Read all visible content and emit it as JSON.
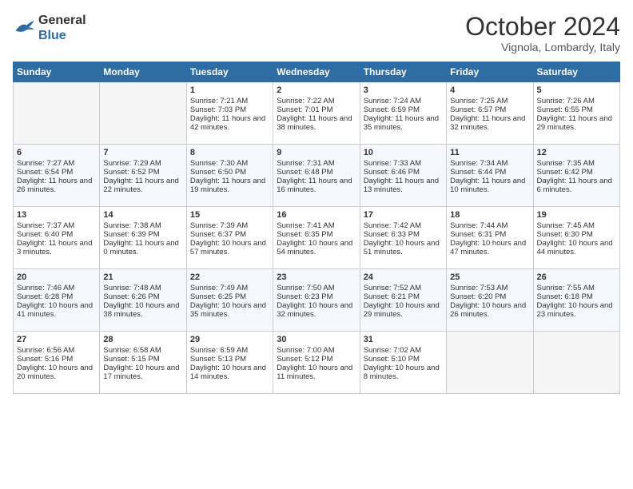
{
  "header": {
    "logo_line1": "General",
    "logo_line2": "Blue",
    "month": "October 2024",
    "location": "Vignola, Lombardy, Italy"
  },
  "days_of_week": [
    "Sunday",
    "Monday",
    "Tuesday",
    "Wednesday",
    "Thursday",
    "Friday",
    "Saturday"
  ],
  "weeks": [
    [
      {
        "day": "",
        "empty": true
      },
      {
        "day": "",
        "empty": true
      },
      {
        "day": "1",
        "sunrise": "Sunrise: 7:21 AM",
        "sunset": "Sunset: 7:03 PM",
        "daylight": "Daylight: 11 hours and 42 minutes."
      },
      {
        "day": "2",
        "sunrise": "Sunrise: 7:22 AM",
        "sunset": "Sunset: 7:01 PM",
        "daylight": "Daylight: 11 hours and 38 minutes."
      },
      {
        "day": "3",
        "sunrise": "Sunrise: 7:24 AM",
        "sunset": "Sunset: 6:59 PM",
        "daylight": "Daylight: 11 hours and 35 minutes."
      },
      {
        "day": "4",
        "sunrise": "Sunrise: 7:25 AM",
        "sunset": "Sunset: 6:57 PM",
        "daylight": "Daylight: 11 hours and 32 minutes."
      },
      {
        "day": "5",
        "sunrise": "Sunrise: 7:26 AM",
        "sunset": "Sunset: 6:55 PM",
        "daylight": "Daylight: 11 hours and 29 minutes."
      }
    ],
    [
      {
        "day": "6",
        "sunrise": "Sunrise: 7:27 AM",
        "sunset": "Sunset: 6:54 PM",
        "daylight": "Daylight: 11 hours and 26 minutes."
      },
      {
        "day": "7",
        "sunrise": "Sunrise: 7:29 AM",
        "sunset": "Sunset: 6:52 PM",
        "daylight": "Daylight: 11 hours and 22 minutes."
      },
      {
        "day": "8",
        "sunrise": "Sunrise: 7:30 AM",
        "sunset": "Sunset: 6:50 PM",
        "daylight": "Daylight: 11 hours and 19 minutes."
      },
      {
        "day": "9",
        "sunrise": "Sunrise: 7:31 AM",
        "sunset": "Sunset: 6:48 PM",
        "daylight": "Daylight: 11 hours and 16 minutes."
      },
      {
        "day": "10",
        "sunrise": "Sunrise: 7:33 AM",
        "sunset": "Sunset: 6:46 PM",
        "daylight": "Daylight: 11 hours and 13 minutes."
      },
      {
        "day": "11",
        "sunrise": "Sunrise: 7:34 AM",
        "sunset": "Sunset: 6:44 PM",
        "daylight": "Daylight: 11 hours and 10 minutes."
      },
      {
        "day": "12",
        "sunrise": "Sunrise: 7:35 AM",
        "sunset": "Sunset: 6:42 PM",
        "daylight": "Daylight: 11 hours and 6 minutes."
      }
    ],
    [
      {
        "day": "13",
        "sunrise": "Sunrise: 7:37 AM",
        "sunset": "Sunset: 6:40 PM",
        "daylight": "Daylight: 11 hours and 3 minutes."
      },
      {
        "day": "14",
        "sunrise": "Sunrise: 7:38 AM",
        "sunset": "Sunset: 6:39 PM",
        "daylight": "Daylight: 11 hours and 0 minutes."
      },
      {
        "day": "15",
        "sunrise": "Sunrise: 7:39 AM",
        "sunset": "Sunset: 6:37 PM",
        "daylight": "Daylight: 10 hours and 57 minutes."
      },
      {
        "day": "16",
        "sunrise": "Sunrise: 7:41 AM",
        "sunset": "Sunset: 6:35 PM",
        "daylight": "Daylight: 10 hours and 54 minutes."
      },
      {
        "day": "17",
        "sunrise": "Sunrise: 7:42 AM",
        "sunset": "Sunset: 6:33 PM",
        "daylight": "Daylight: 10 hours and 51 minutes."
      },
      {
        "day": "18",
        "sunrise": "Sunrise: 7:44 AM",
        "sunset": "Sunset: 6:31 PM",
        "daylight": "Daylight: 10 hours and 47 minutes."
      },
      {
        "day": "19",
        "sunrise": "Sunrise: 7:45 AM",
        "sunset": "Sunset: 6:30 PM",
        "daylight": "Daylight: 10 hours and 44 minutes."
      }
    ],
    [
      {
        "day": "20",
        "sunrise": "Sunrise: 7:46 AM",
        "sunset": "Sunset: 6:28 PM",
        "daylight": "Daylight: 10 hours and 41 minutes."
      },
      {
        "day": "21",
        "sunrise": "Sunrise: 7:48 AM",
        "sunset": "Sunset: 6:26 PM",
        "daylight": "Daylight: 10 hours and 38 minutes."
      },
      {
        "day": "22",
        "sunrise": "Sunrise: 7:49 AM",
        "sunset": "Sunset: 6:25 PM",
        "daylight": "Daylight: 10 hours and 35 minutes."
      },
      {
        "day": "23",
        "sunrise": "Sunrise: 7:50 AM",
        "sunset": "Sunset: 6:23 PM",
        "daylight": "Daylight: 10 hours and 32 minutes."
      },
      {
        "day": "24",
        "sunrise": "Sunrise: 7:52 AM",
        "sunset": "Sunset: 6:21 PM",
        "daylight": "Daylight: 10 hours and 29 minutes."
      },
      {
        "day": "25",
        "sunrise": "Sunrise: 7:53 AM",
        "sunset": "Sunset: 6:20 PM",
        "daylight": "Daylight: 10 hours and 26 minutes."
      },
      {
        "day": "26",
        "sunrise": "Sunrise: 7:55 AM",
        "sunset": "Sunset: 6:18 PM",
        "daylight": "Daylight: 10 hours and 23 minutes."
      }
    ],
    [
      {
        "day": "27",
        "sunrise": "Sunrise: 6:56 AM",
        "sunset": "Sunset: 5:16 PM",
        "daylight": "Daylight: 10 hours and 20 minutes."
      },
      {
        "day": "28",
        "sunrise": "Sunrise: 6:58 AM",
        "sunset": "Sunset: 5:15 PM",
        "daylight": "Daylight: 10 hours and 17 minutes."
      },
      {
        "day": "29",
        "sunrise": "Sunrise: 6:59 AM",
        "sunset": "Sunset: 5:13 PM",
        "daylight": "Daylight: 10 hours and 14 minutes."
      },
      {
        "day": "30",
        "sunrise": "Sunrise: 7:00 AM",
        "sunset": "Sunset: 5:12 PM",
        "daylight": "Daylight: 10 hours and 11 minutes."
      },
      {
        "day": "31",
        "sunrise": "Sunrise: 7:02 AM",
        "sunset": "Sunset: 5:10 PM",
        "daylight": "Daylight: 10 hours and 8 minutes."
      },
      {
        "day": "",
        "empty": true
      },
      {
        "day": "",
        "empty": true
      }
    ]
  ]
}
